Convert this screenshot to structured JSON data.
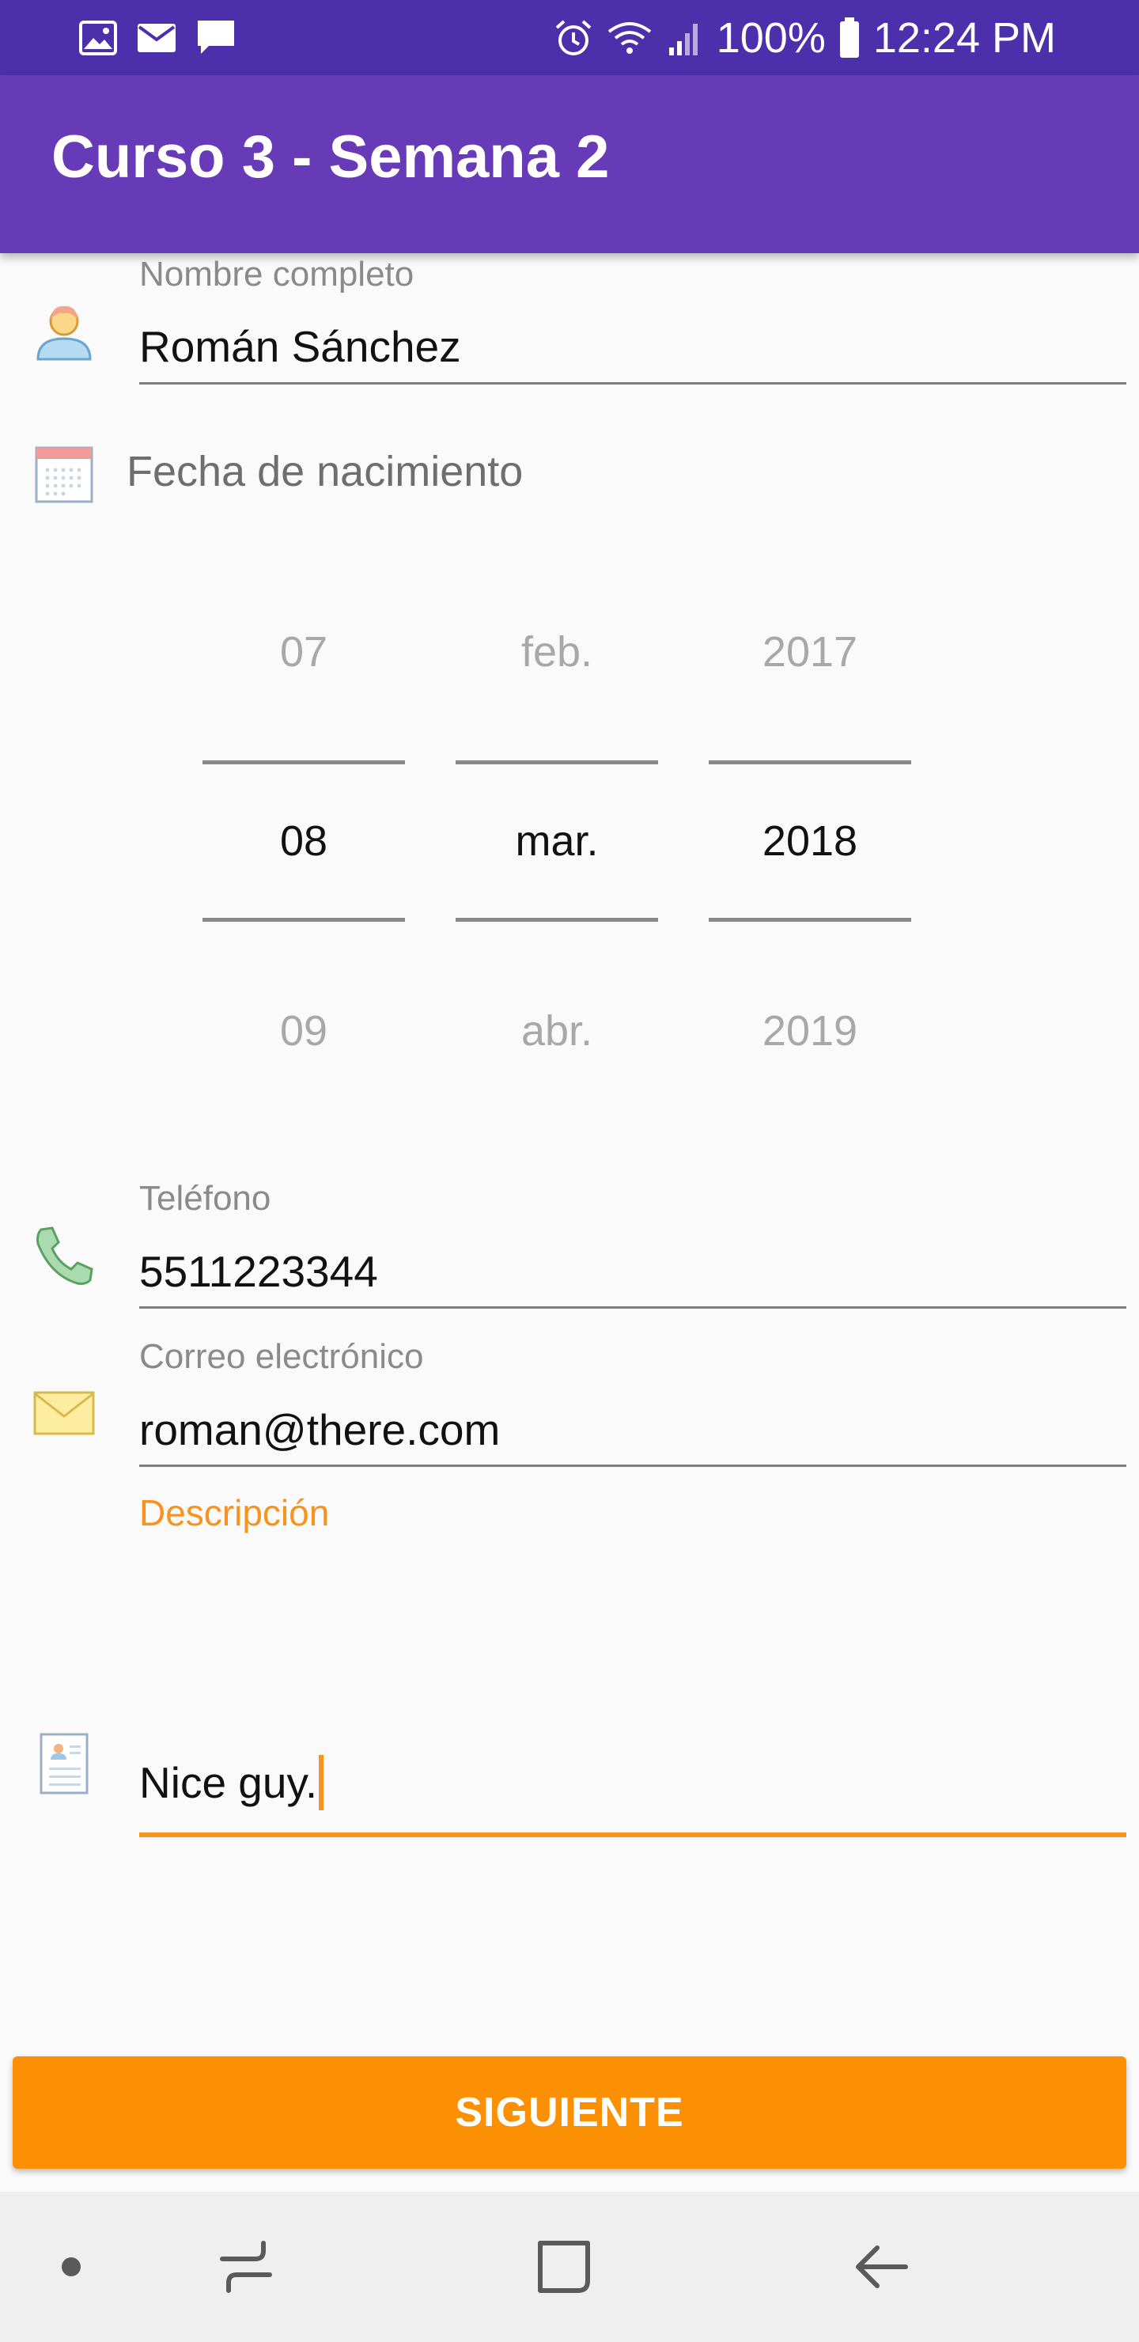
{
  "status_bar": {
    "battery": "100%",
    "time": "12:24 PM",
    "left_icons": [
      "image-icon",
      "mail-icon",
      "message-icon"
    ],
    "right_icons": [
      "alarm-icon",
      "wifi-icon",
      "signal-icon",
      "battery-icon"
    ]
  },
  "app_bar": {
    "title": "Curso 3 - Semana 2"
  },
  "form": {
    "name": {
      "label": "Nombre completo",
      "value": "Román Sánchez",
      "icon": "user-icon"
    },
    "birth_date": {
      "label": "Fecha de nacimiento",
      "icon": "calendar-icon",
      "picker": {
        "day": {
          "prev": "07",
          "selected": "08",
          "next": "09"
        },
        "month": {
          "prev": "feb.",
          "selected": "mar.",
          "next": "abr."
        },
        "year": {
          "prev": "2017",
          "selected": "2018",
          "next": "2019"
        }
      }
    },
    "phone": {
      "label": "Teléfono",
      "value": "5511223344",
      "icon": "phone-icon"
    },
    "email": {
      "label": "Correo electrónico",
      "value": "roman@there.com",
      "icon": "envelope-icon"
    },
    "description": {
      "label": "Descripción",
      "value": "Nice guy.",
      "icon": "contact-card-icon"
    }
  },
  "next_button": {
    "label": "SIGUIENTE"
  },
  "nav_bar": {
    "items": [
      "dot-icon",
      "recents-icon",
      "home-icon",
      "back-icon"
    ]
  },
  "colors": {
    "status_bar": "#4b2fab",
    "app_bar": "#673ab7",
    "accent": "#fb9005",
    "focus_label": "#f7931e"
  }
}
